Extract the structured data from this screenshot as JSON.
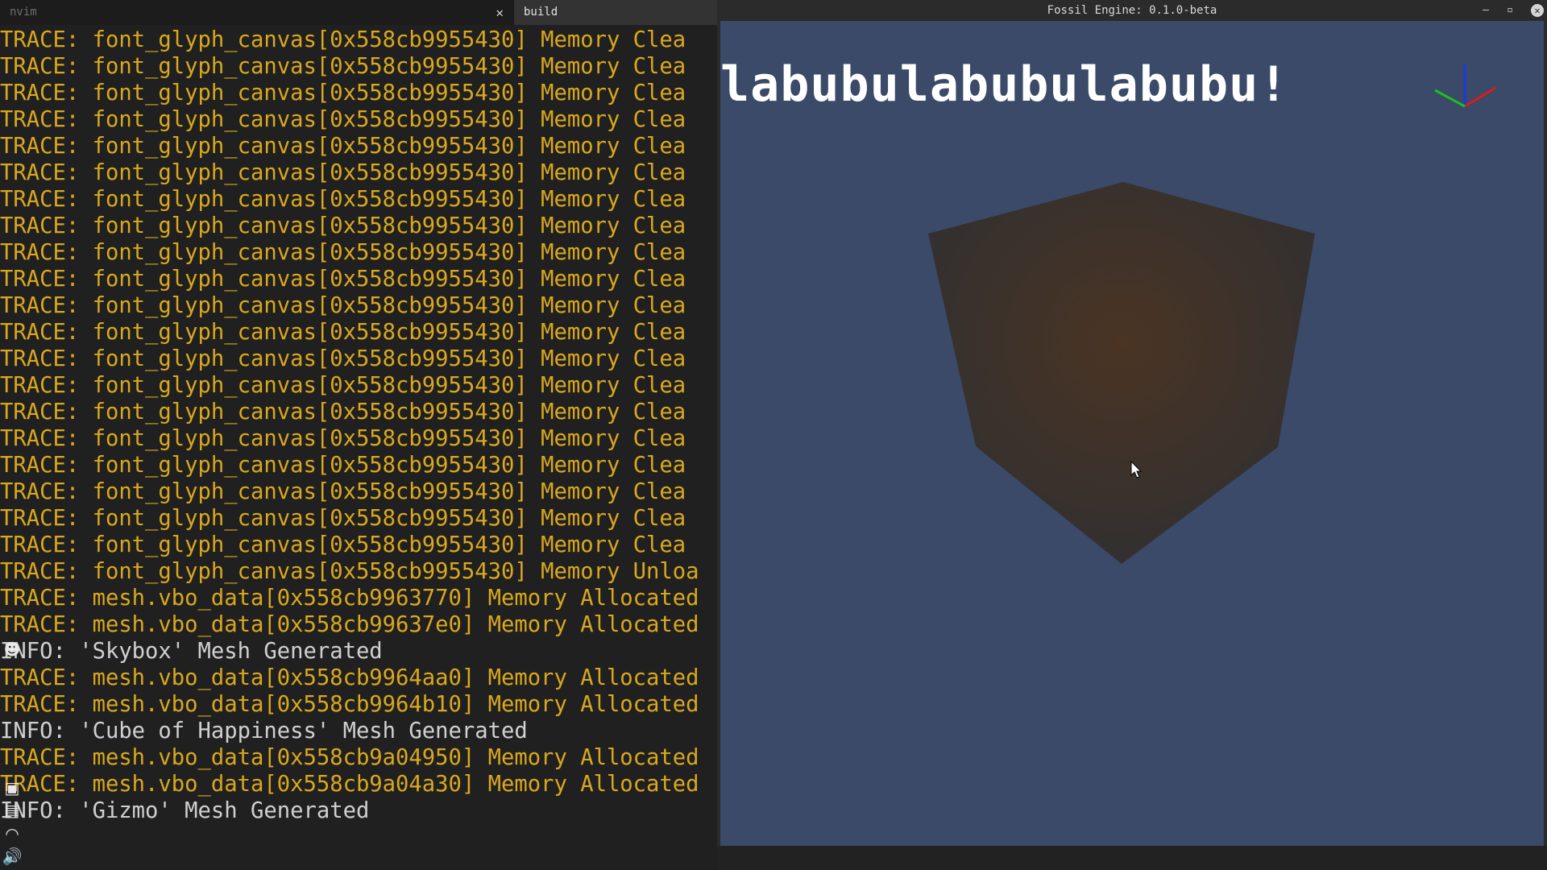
{
  "terminal": {
    "tabs": [
      {
        "label": "nvim",
        "active": false
      },
      {
        "label": "build",
        "active": true
      }
    ],
    "close_glyph": "✕",
    "lines": [
      {
        "level": "TRACE",
        "text": "TRACE: font_glyph_canvas[0x558cb9955430] Memory Clea"
      },
      {
        "level": "TRACE",
        "text": "TRACE: font_glyph_canvas[0x558cb9955430] Memory Clea"
      },
      {
        "level": "TRACE",
        "text": "TRACE: font_glyph_canvas[0x558cb9955430] Memory Clea"
      },
      {
        "level": "TRACE",
        "text": "TRACE: font_glyph_canvas[0x558cb9955430] Memory Clea"
      },
      {
        "level": "TRACE",
        "text": "TRACE: font_glyph_canvas[0x558cb9955430] Memory Clea"
      },
      {
        "level": "TRACE",
        "text": "TRACE: font_glyph_canvas[0x558cb9955430] Memory Clea"
      },
      {
        "level": "TRACE",
        "text": "TRACE: font_glyph_canvas[0x558cb9955430] Memory Clea"
      },
      {
        "level": "TRACE",
        "text": "TRACE: font_glyph_canvas[0x558cb9955430] Memory Clea"
      },
      {
        "level": "TRACE",
        "text": "TRACE: font_glyph_canvas[0x558cb9955430] Memory Clea"
      },
      {
        "level": "TRACE",
        "text": "TRACE: font_glyph_canvas[0x558cb9955430] Memory Clea"
      },
      {
        "level": "TRACE",
        "text": "TRACE: font_glyph_canvas[0x558cb9955430] Memory Clea"
      },
      {
        "level": "TRACE",
        "text": "TRACE: font_glyph_canvas[0x558cb9955430] Memory Clea"
      },
      {
        "level": "TRACE",
        "text": "TRACE: font_glyph_canvas[0x558cb9955430] Memory Clea"
      },
      {
        "level": "TRACE",
        "text": "TRACE: font_glyph_canvas[0x558cb9955430] Memory Clea"
      },
      {
        "level": "TRACE",
        "text": "TRACE: font_glyph_canvas[0x558cb9955430] Memory Clea"
      },
      {
        "level": "TRACE",
        "text": "TRACE: font_glyph_canvas[0x558cb9955430] Memory Clea"
      },
      {
        "level": "TRACE",
        "text": "TRACE: font_glyph_canvas[0x558cb9955430] Memory Clea"
      },
      {
        "level": "TRACE",
        "text": "TRACE: font_glyph_canvas[0x558cb9955430] Memory Clea"
      },
      {
        "level": "TRACE",
        "text": "TRACE: font_glyph_canvas[0x558cb9955430] Memory Clea"
      },
      {
        "level": "TRACE",
        "text": "TRACE: font_glyph_canvas[0x558cb9955430] Memory Clea"
      },
      {
        "level": "TRACE",
        "text": "TRACE: font_glyph_canvas[0x558cb9955430] Memory Unloa"
      },
      {
        "level": "TRACE",
        "text": "TRACE: mesh.vbo_data[0x558cb9963770] Memory Allocated"
      },
      {
        "level": "TRACE",
        "text": "TRACE: mesh.vbo_data[0x558cb99637e0] Memory Allocated"
      },
      {
        "level": "INFO",
        "text": "INFO: 'Skybox' Mesh Generated"
      },
      {
        "level": "TRACE",
        "text": "TRACE: mesh.vbo_data[0x558cb9964aa0] Memory Allocated"
      },
      {
        "level": "TRACE",
        "text": "TRACE: mesh.vbo_data[0x558cb9964b10] Memory Allocated"
      },
      {
        "level": "INFO",
        "text": "INFO: 'Cube of Happiness' Mesh Generated"
      },
      {
        "level": "TRACE",
        "text": "TRACE: mesh.vbo_data[0x558cb9a04950] Memory Allocated"
      },
      {
        "level": "TRACE",
        "text": "TRACE: mesh.vbo_data[0x558cb9a04a30] Memory Allocated"
      },
      {
        "level": "INFO",
        "text": "INFO: 'Gizmo' Mesh Generated"
      }
    ]
  },
  "side_icons": [
    {
      "name": "discord-icon",
      "glyph": "☻"
    },
    {
      "name": "clipboard-lock-icon",
      "glyph": "▣"
    },
    {
      "name": "clipboard-icon",
      "glyph": "▤"
    },
    {
      "name": "wifi-icon",
      "glyph": "◠"
    },
    {
      "name": "volume-icon",
      "glyph": "🔊"
    }
  ],
  "engine": {
    "title": "Fossil Engine: 0.1.0-beta",
    "window_buttons": {
      "minimize": "–",
      "maximize": "▫",
      "close": "✕"
    },
    "banner_text": "labubulabubulabubu!",
    "colors": {
      "viewport_bg": "#3a4a68",
      "gizmo_x": "#e01a1a",
      "gizmo_y": "#1a3ae0",
      "gizmo_z": "#1ac21a",
      "cube_face": "#33302f",
      "cube_glow": "#4a3424"
    }
  }
}
